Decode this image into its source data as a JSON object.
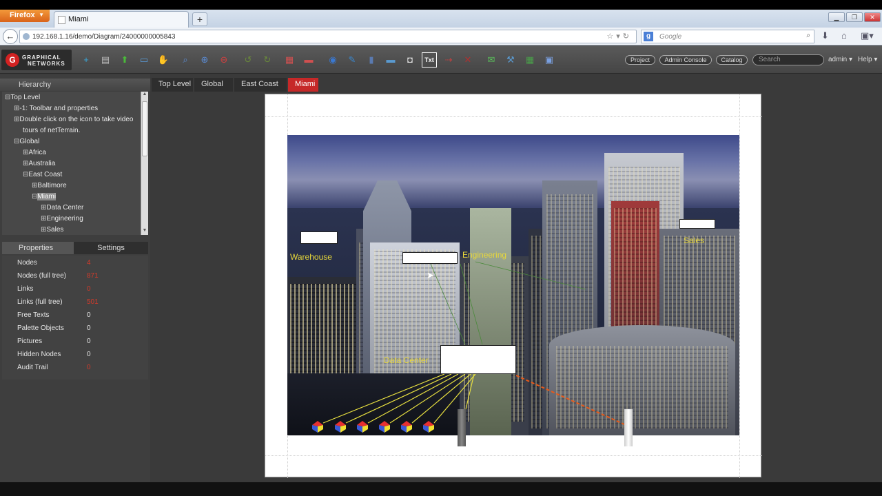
{
  "browser": {
    "firefox_label": "Firefox",
    "tab_title": "Miami",
    "new_tab": "+",
    "url": "192.168.1.16/demo/Diagram/24000000005843",
    "search_engine_icon": "google-icon",
    "search_placeholder": "Google"
  },
  "app": {
    "logo_line1": "GRAPHICAL",
    "logo_line2": "NETWORKS",
    "toolbar_buttons": [
      {
        "name": "add-document-icon",
        "glyph": "+",
        "color": "#3aa7d9"
      },
      {
        "name": "print-icon",
        "glyph": "▤",
        "color": "#bbbbbb"
      },
      {
        "name": "up-level-icon",
        "glyph": "⬆",
        "color": "#4aba3a"
      },
      {
        "name": "window-icon",
        "glyph": "▭",
        "color": "#5aa0e0"
      },
      {
        "name": "hand-pan-icon",
        "glyph": "✋",
        "color": "#e8b830"
      },
      {
        "name": "zoom-icon",
        "glyph": "⌕",
        "color": "#5a8ad0"
      },
      {
        "name": "zoom-in-icon",
        "glyph": "⊕",
        "color": "#5a8ad0"
      },
      {
        "name": "zoom-out-icon",
        "glyph": "⊖",
        "color": "#d04040"
      },
      {
        "name": "undo-icon",
        "glyph": "↺",
        "color": "#6a8a3a"
      },
      {
        "name": "redo-icon",
        "glyph": "↻",
        "color": "#6a8a3a"
      },
      {
        "name": "nodes-icon",
        "glyph": "▦",
        "color": "#d05050"
      },
      {
        "name": "layout-icon",
        "glyph": "▬",
        "color": "#d05050"
      },
      {
        "name": "globe-icon",
        "glyph": "◉",
        "color": "#3a78d0"
      },
      {
        "name": "link-icon",
        "glyph": "✎",
        "color": "#3a88d0"
      },
      {
        "name": "door-icon",
        "glyph": "▮",
        "color": "#5a7ab0"
      },
      {
        "name": "device-icon",
        "glyph": "▬",
        "color": "#5a9ad0"
      },
      {
        "name": "camera-icon",
        "glyph": "◘",
        "color": "#dddddd"
      },
      {
        "name": "text-icon",
        "glyph": "Txt",
        "color": "#ffffff"
      },
      {
        "name": "pointer-icon",
        "glyph": "⇢",
        "color": "#c04040"
      },
      {
        "name": "delete-icon",
        "glyph": "✕",
        "color": "#b03030"
      },
      {
        "name": "mail-icon",
        "glyph": "✉",
        "color": "#5ac05a"
      },
      {
        "name": "user-tools-icon",
        "glyph": "⚒",
        "color": "#5a9ad0"
      },
      {
        "name": "spreadsheet-icon",
        "glyph": "▦",
        "color": "#4aa04a"
      },
      {
        "name": "report-icon",
        "glyph": "▣",
        "color": "#7aa0e0"
      }
    ],
    "project_label": "Project",
    "admin_console_label": "Admin Console",
    "catalog_label": "Catalog",
    "search_placeholder": "Search",
    "user_label": "admin",
    "help_label": "Help"
  },
  "hierarchy": {
    "title": "Hierarchy",
    "rows": [
      {
        "exp": "⊟",
        "label": "Top Level",
        "indent": 0
      },
      {
        "exp": "⊞",
        "label": "-1: Toolbar and properties",
        "indent": 1
      },
      {
        "exp": "⊞",
        "label": "Double click on the icon to take video",
        "indent": 1
      },
      {
        "exp": "",
        "label": "tours of netTerrain.",
        "indent": 2
      },
      {
        "exp": "⊟",
        "label": "Global",
        "indent": 1
      },
      {
        "exp": "⊞",
        "label": "Africa",
        "indent": 2
      },
      {
        "exp": "⊞",
        "label": "Australia",
        "indent": 2
      },
      {
        "exp": "⊟",
        "label": "East Coast",
        "indent": 2
      },
      {
        "exp": "⊞",
        "label": "Baltimore",
        "indent": 3
      },
      {
        "exp": "⊟",
        "label": "Miami",
        "indent": 3,
        "selected": true
      },
      {
        "exp": "⊞",
        "label": "Data Center",
        "indent": 4
      },
      {
        "exp": "⊞",
        "label": "Engineering",
        "indent": 4
      },
      {
        "exp": "⊞",
        "label": "Sales",
        "indent": 4
      }
    ]
  },
  "properties": {
    "tab_properties": "Properties",
    "tab_settings": "Settings",
    "rows": [
      {
        "key": "Nodes",
        "value": "4",
        "red": true
      },
      {
        "key": "Nodes (full tree)",
        "value": "871",
        "red": true
      },
      {
        "key": "Links",
        "value": "0",
        "red": true
      },
      {
        "key": "Links (full tree)",
        "value": "501",
        "red": true
      },
      {
        "key": "Free Texts",
        "value": "0",
        "red": false
      },
      {
        "key": "Palette Objects",
        "value": "0",
        "red": false
      },
      {
        "key": "Pictures",
        "value": "0",
        "red": false
      },
      {
        "key": "Hidden Nodes",
        "value": "0",
        "red": false
      },
      {
        "key": "Audit Trail",
        "value": "0",
        "red": true
      }
    ]
  },
  "breadcrumb": [
    "Top Level",
    "Global",
    "East Coast",
    "Miami"
  ],
  "diagram": {
    "labels": {
      "warehouse": "Warehouse",
      "engineering": "Engineering",
      "sales": "Sales",
      "data_center": "Data Center"
    },
    "link_color": "#e8e040",
    "dashed_link_color": "#e85a1a"
  }
}
